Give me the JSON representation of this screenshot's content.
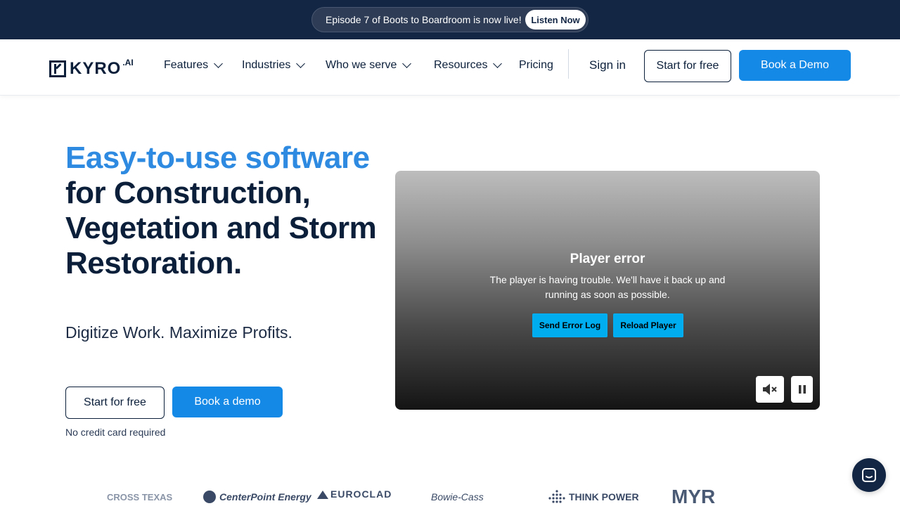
{
  "announcement": {
    "text": "Episode 7 of Boots to Boardroom is now live!",
    "button_label": "Listen Now"
  },
  "nav": {
    "logo_text": "KYRO",
    "logo_suffix": ".AI",
    "items": [
      {
        "label": "Features",
        "has_dropdown": true
      },
      {
        "label": "Industries",
        "has_dropdown": true
      },
      {
        "label": "Who we serve",
        "has_dropdown": true
      },
      {
        "label": "Resources",
        "has_dropdown": true
      },
      {
        "label": "Pricing",
        "has_dropdown": false
      }
    ],
    "signin_label": "Sign in",
    "start_free_label": "Start for free",
    "book_demo_label": "Book a Demo"
  },
  "hero": {
    "title_accent": "Easy-to-use software",
    "title_rest": "for Construction, Vegetation and Storm Restoration.",
    "subtitle": "Digitize Work. Maximize Profits.",
    "start_free_label": "Start for free",
    "book_demo_label": "Book a demo",
    "note": "No credit card required"
  },
  "player": {
    "error_title": "Player error",
    "error_message": "The player is having trouble. We'll have it back up and running as soon as possible.",
    "send_log_label": "Send Error Log",
    "reload_label": "Reload Player",
    "mute_icon": "muted-speaker-icon",
    "pause_icon": "pause-icon"
  },
  "client_logos": [
    {
      "name": "CROSS TEXAS"
    },
    {
      "name": "CenterPoint Energy"
    },
    {
      "name": "EUROCLAD"
    },
    {
      "name": "Bowie-Cass"
    },
    {
      "name": "THINK POWER"
    },
    {
      "name": "MYR"
    }
  ],
  "colors": {
    "navy": "#132745",
    "accent_blue": "#1589e6",
    "title_accent": "#2d8ae0",
    "player_button": "#00adef"
  }
}
